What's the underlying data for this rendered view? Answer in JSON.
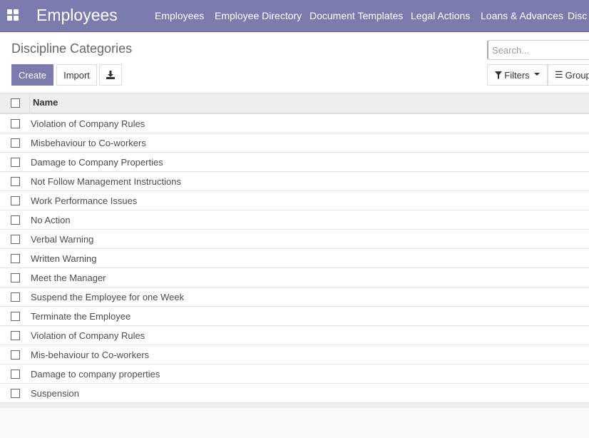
{
  "nav": {
    "brand": "Employees",
    "menu": [
      "Employees",
      "Employee Directory",
      "Document Templates",
      "Legal Actions",
      "Loans & Advances",
      "Disc"
    ]
  },
  "control_panel": {
    "title": "Discipline Categories",
    "create": "Create",
    "import": "Import",
    "search_placeholder": "Search...",
    "filters": "Filters",
    "group_by": "Group"
  },
  "table": {
    "header": "Name",
    "rows": [
      "Violation of Company Rules",
      "Misbehaviour to Co-workers",
      "Damage to Company Properties",
      "Not Follow Management Instructions",
      "Work Performance Issues",
      "No Action",
      "Verbal Warning",
      "Written Warning",
      "Meet the Manager",
      "Suspend the Employee for one Week",
      "Terminate the Employee",
      "Violation of Company Rules",
      "Mis-behaviour to Co-workers",
      "Damage to company properties",
      "Suspension"
    ]
  }
}
